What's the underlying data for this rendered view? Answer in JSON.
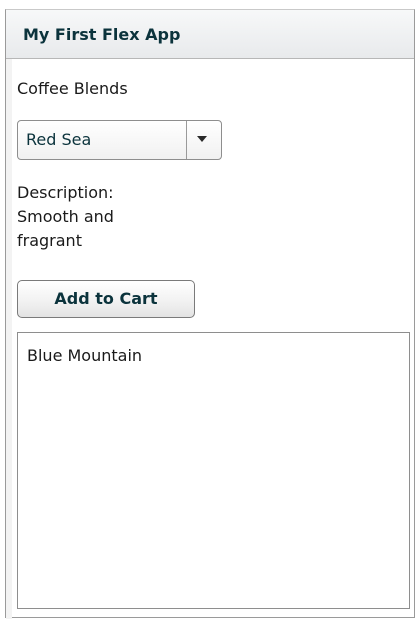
{
  "panel": {
    "title": "My First Flex App"
  },
  "form": {
    "coffee_label": "Coffee Blends",
    "blend_select": {
      "selected": "Red Sea"
    },
    "description_lines": [
      "Description:",
      "Smooth and",
      "fragrant"
    ],
    "add_button_label": "Add to Cart"
  },
  "cart": {
    "items": [
      "Blue Mountain"
    ]
  },
  "colors": {
    "header_bg": "#eceef0",
    "title_text": "#0b333c",
    "border": "#8e8e8e"
  }
}
